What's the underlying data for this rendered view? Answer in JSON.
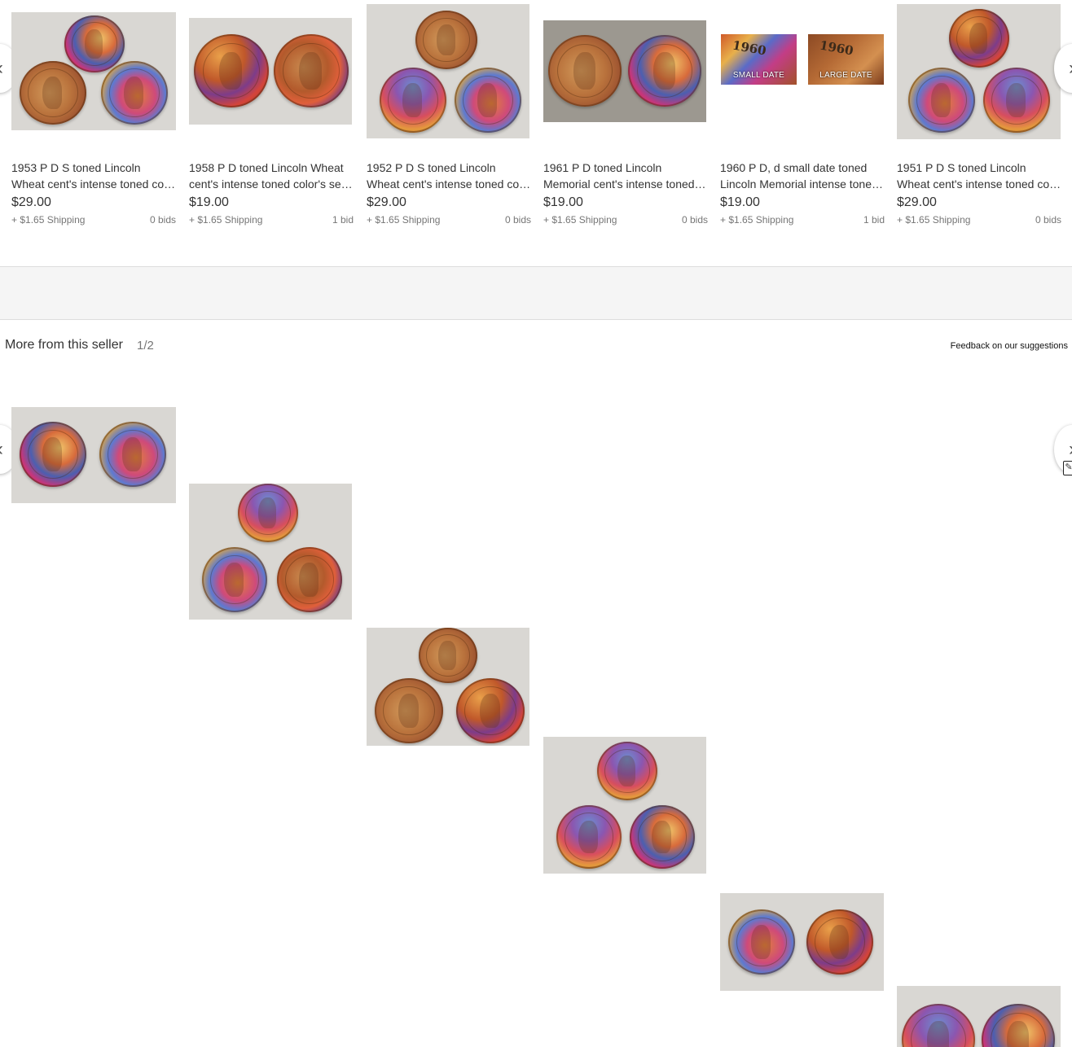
{
  "top_carousel": {
    "prev_icon": "‹",
    "next_icon": "›",
    "items": [
      {
        "title_line1": "1953 P D S toned Lincoln",
        "title_line2": "Wheat cent's intense toned co…",
        "price": "$29.00",
        "shipping": "+ $1.65 Shipping",
        "bids": "0 bids"
      },
      {
        "title_line1": "1958 P D toned Lincoln Wheat",
        "title_line2": "cent's intense toned color's se…",
        "price": "$19.00",
        "shipping": "+ $1.65 Shipping",
        "bids": "1 bid"
      },
      {
        "title_line1": "1952 P D S toned Lincoln",
        "title_line2": "Wheat cent's intense toned co…",
        "price": "$29.00",
        "shipping": "+ $1.65 Shipping",
        "bids": "0 bids"
      },
      {
        "title_line1": "1961 P D toned Lincoln",
        "title_line2": "Memorial cent's intense toned…",
        "price": "$19.00",
        "shipping": "+ $1.65 Shipping",
        "bids": "0 bids"
      },
      {
        "title_line1": "1960 P D, d small date toned",
        "title_line2": "Lincoln Memorial intense tone…",
        "price": "$19.00",
        "shipping": "+ $1.65 Shipping",
        "bids": "1 bid",
        "image_labels": [
          "SMALL DATE",
          "LARGE DATE"
        ],
        "image_digits": [
          "1960",
          "1960"
        ]
      },
      {
        "title_line1": "1951 P D S toned Lincoln",
        "title_line2": "Wheat cent's intense toned co…",
        "price": "$29.00",
        "shipping": "+ $1.65 Shipping",
        "bids": "0 bids"
      }
    ]
  },
  "seller_section": {
    "title": "More from this seller",
    "page": "1/2",
    "feedback_link": "Feedback on our suggestions",
    "prev_icon": "‹",
    "next_icon": "›"
  },
  "cursor_icon": "✎"
}
